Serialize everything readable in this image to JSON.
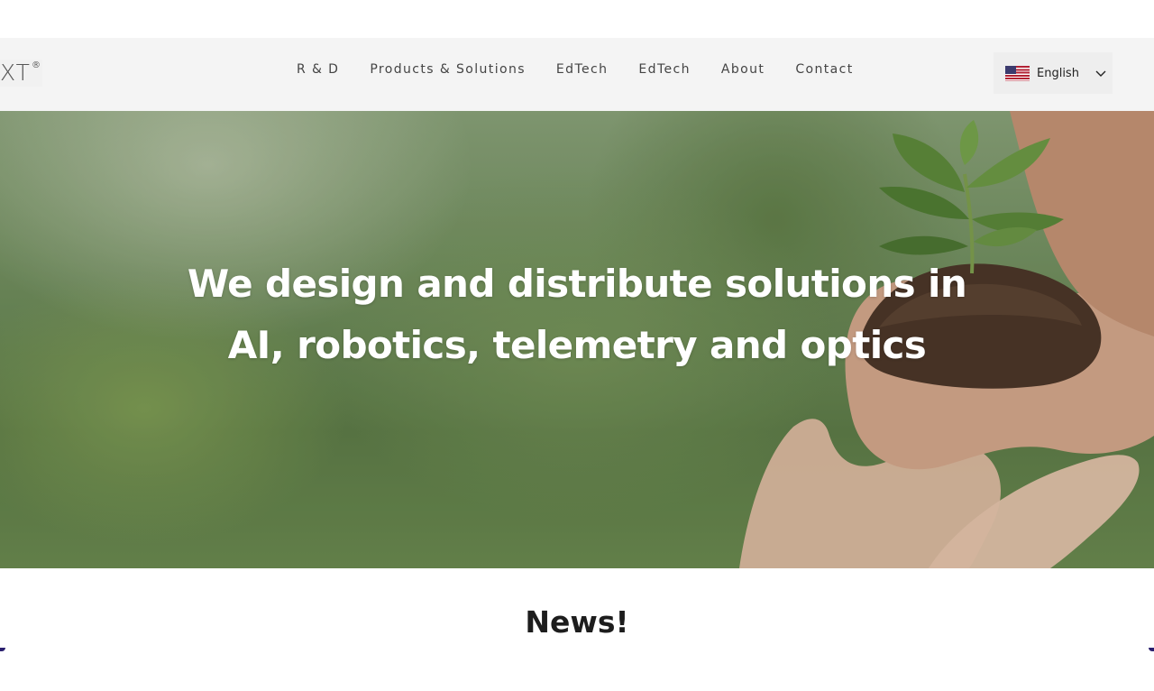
{
  "header": {
    "logo_text": "XT",
    "logo_mark": "®",
    "nav": [
      {
        "label": "R & D"
      },
      {
        "label": "Products & Solutions"
      },
      {
        "label": "EdTech"
      },
      {
        "label": "EdTech"
      },
      {
        "label": "About"
      },
      {
        "label": "Contact"
      }
    ],
    "language": {
      "label": "English",
      "flag_icon": "us-flag-icon",
      "chevron_icon": "chevron-down-icon"
    }
  },
  "hero": {
    "headline_line1": "We design and distribute solutions in",
    "headline_line2": "AI, robotics, telemetry and optics",
    "background_colors": {
      "foliage": "#6f8d5c",
      "soil": "#4a3326",
      "skin": "#e0b59a"
    }
  },
  "news": {
    "title": "News!"
  }
}
